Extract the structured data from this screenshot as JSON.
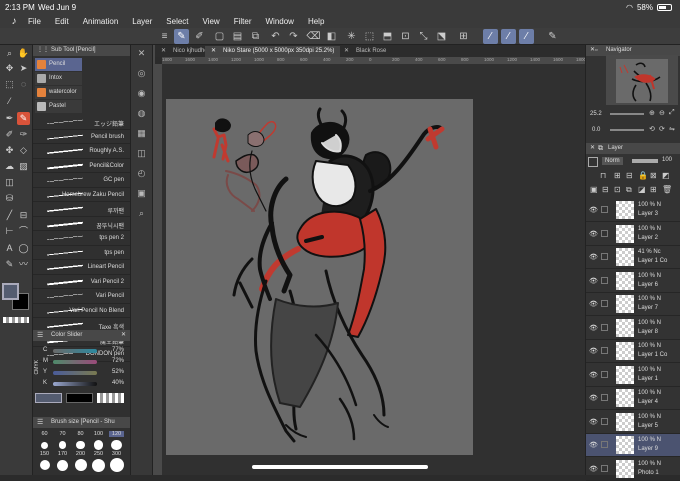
{
  "status": {
    "time": "2:13 PM",
    "date": "Wed Jun 9",
    "battery": "58%"
  },
  "menu": [
    "File",
    "Edit",
    "Animation",
    "Layer",
    "Select",
    "View",
    "Filter",
    "Window",
    "Help"
  ],
  "doc_tabs": [
    "Nico kjhudhdhf",
    "Niko Stare (5000 x 5000px 350dpi 25.2%)",
    "Black Rose"
  ],
  "ruler_ticks": [
    "1800",
    "1600",
    "1400",
    "1200",
    "1000",
    "800",
    "600",
    "400",
    "200",
    "0",
    "200",
    "400",
    "600",
    "800",
    "1000",
    "1200",
    "1400",
    "1600",
    "1800",
    "2000",
    "2200",
    "2400",
    "2600",
    "2800",
    "3000",
    "3200",
    "3400",
    "3600",
    "3800",
    "4000",
    "4200",
    "4400",
    "4600",
    "4800",
    "5000"
  ],
  "subtool": {
    "title": "Sub Tool [Pencil]",
    "tabs": [
      "Pencil",
      "Intox",
      "watercolor",
      "Pastel"
    ],
    "brushes": [
      "エッジ鉛筆",
      "Pencil brush",
      "Roughly A.S.",
      "Pencil&Color",
      "GC pen",
      "Homebrew Zaku Pencil",
      "루까팬",
      "꿈뚜닉시팬",
      "tps pen 2",
      "tps pen",
      "Lineart Pencil",
      "Vari Pencil 2",
      "Vari Pencil",
      "Vari Pencil No Blend",
      "Taxe 흑색",
      "魔王鉛筆",
      "DONDON pen"
    ]
  },
  "color_slider": {
    "title": "Color Slider",
    "mode": "CMYK",
    "channels": [
      {
        "label": "C",
        "value": "77%"
      },
      {
        "label": "M",
        "value": "72%"
      },
      {
        "label": "Y",
        "value": "52%"
      },
      {
        "label": "K",
        "value": "40%"
      }
    ]
  },
  "brush_size": {
    "title": "Brush size [Pencil - Shu",
    "values": [
      "60",
      "70",
      "80",
      "100",
      "120",
      "150",
      "170",
      "200",
      "250",
      "300"
    ]
  },
  "navigator": {
    "title": "Navigator",
    "zoom": "25.2",
    "rotation": "0.0"
  },
  "layer_panel": {
    "title": "Layer",
    "blend": "Norm",
    "opacity": "100"
  },
  "layers": [
    {
      "opacity": "100 % N",
      "name": "Layer 3"
    },
    {
      "opacity": "100 % N",
      "name": "Layer 2"
    },
    {
      "opacity": "41 % Nc",
      "name": "Layer 1 Co"
    },
    {
      "opacity": "100 % N",
      "name": "Layer 6"
    },
    {
      "opacity": "100 % N",
      "name": "Layer 7"
    },
    {
      "opacity": "100 % N",
      "name": "Layer 8"
    },
    {
      "opacity": "100 % N",
      "name": "Layer 1 Co"
    },
    {
      "opacity": "100 % N",
      "name": "Layer 1"
    },
    {
      "opacity": "100 % N",
      "name": "Layer 4"
    },
    {
      "opacity": "100 % N",
      "name": "Layer 5"
    },
    {
      "opacity": "100 % N",
      "name": "Layer 9"
    },
    {
      "opacity": "100 % N",
      "name": "Photo 1"
    }
  ]
}
